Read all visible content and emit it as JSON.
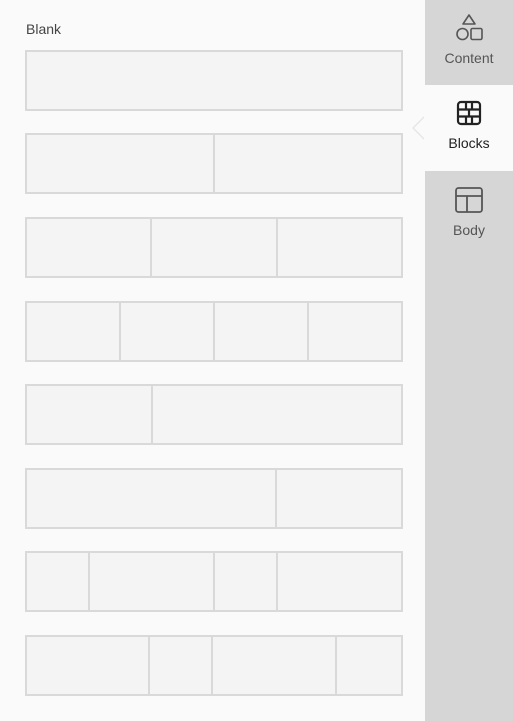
{
  "main": {
    "section_title": "Blank",
    "layouts": [
      {
        "name": "1 column",
        "columns": [
          1
        ]
      },
      {
        "name": "2 columns",
        "columns": [
          1,
          1
        ]
      },
      {
        "name": "3 columns",
        "columns": [
          1,
          1,
          1
        ]
      },
      {
        "name": "4 columns",
        "columns": [
          1,
          1,
          1,
          1
        ]
      },
      {
        "name": "1/3 + 2/3",
        "columns": [
          1,
          2
        ]
      },
      {
        "name": "2/3 + 1/3",
        "columns": [
          2,
          1
        ]
      },
      {
        "name": "1/6 + 1/3 + 1/6 + 1/3",
        "columns": [
          1,
          2,
          1,
          2
        ]
      },
      {
        "name": "1/3 + 1/6 + 1/3 + 1/6",
        "columns": [
          2,
          1,
          2,
          1.06
        ]
      }
    ]
  },
  "sidebar": {
    "tabs": [
      {
        "id": "content",
        "label": "Content",
        "icon": "shapes-icon",
        "active": false
      },
      {
        "id": "blocks",
        "label": "Blocks",
        "icon": "blocks-icon",
        "active": true
      },
      {
        "id": "body",
        "label": "Body",
        "icon": "layout-icon",
        "active": false
      }
    ]
  },
  "colors": {
    "panel_bg": "#fafafa",
    "sidebar_bg": "#d6d6d6",
    "block_border": "#d9d9d9",
    "block_fill": "#f4f4f4",
    "text": "#444444"
  }
}
